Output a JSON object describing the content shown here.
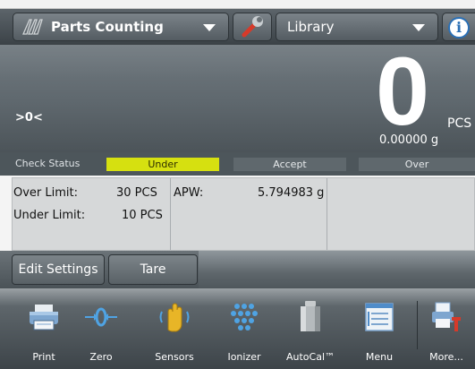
{
  "titlebar": {
    "app_name": "Parts Counting",
    "library_label": "Library"
  },
  "display": {
    "zero_indicator": ">0<",
    "main_value": "0",
    "main_unit": "PCS",
    "secondary_value": "0.00000 g"
  },
  "check": {
    "caption": "Check Status",
    "under": "Under",
    "accept": "Accept",
    "over": "Over",
    "active": "Under"
  },
  "limits": {
    "over_label": "Over Limit:",
    "over_value": "30 PCS",
    "under_label": "Under Limit:",
    "under_value": "10 PCS",
    "apw_label": "APW:",
    "apw_value": "5.794983 g"
  },
  "buttons": {
    "edit_settings": "Edit Settings",
    "tare": "Tare"
  },
  "toolbar": [
    {
      "label": "Print",
      "icon": "printer-icon"
    },
    {
      "label": "Zero",
      "icon": "zero-icon"
    },
    {
      "label": "Sensors",
      "icon": "hand-sensor-icon"
    },
    {
      "label": "Ionizer",
      "icon": "ionizer-icon"
    },
    {
      "label": "AutoCal™",
      "icon": "calibration-weight-icon"
    },
    {
      "label": "Menu",
      "icon": "menu-icon"
    },
    {
      "label": "More...",
      "icon": "more-icon"
    }
  ],
  "colors": {
    "under_highlight": "#d6e010",
    "info_blue": "#2a6fb5",
    "wrench_red": "#d63a2a"
  }
}
